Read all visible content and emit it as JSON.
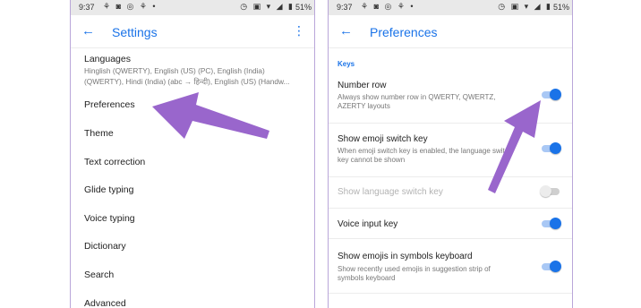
{
  "left_screen": {
    "status_bar": {
      "time": "9:37",
      "left_icons": "⚘ ◙ ◎ ⚘ •",
      "right_icons": "◷ ▣ ▾ ◢ ▮",
      "battery": "51%"
    },
    "toolbar": {
      "title": "Settings"
    },
    "languages": {
      "title": "Languages",
      "line1": "Hinglish (QWERTY), English (US) (PC), English (India)",
      "line2": "(QWERTY), Hindi (India) (abc → हिन्दी), English (US) (Handw..."
    },
    "items": [
      "Preferences",
      "Theme",
      "Text correction",
      "Glide typing",
      "Voice typing",
      "Dictionary",
      "Search",
      "Advanced"
    ]
  },
  "right_screen": {
    "status_bar": {
      "time": "9:37",
      "left_icons": "⚘ ◙ ◎ ⚘ •",
      "right_icons": "◷ ▣ ▾ ◢ ▮",
      "battery": "51%"
    },
    "toolbar": {
      "title": "Preferences"
    },
    "section_keys": "Keys",
    "prefs": [
      {
        "title": "Number row",
        "subtitle": "Always show number row in QWERTY, QWERTZ, AZERTY layouts",
        "enabled": true,
        "disabled": false
      },
      {
        "title": "Show emoji switch key",
        "subtitle": "When emoji switch key is enabled, the language switch key cannot be shown",
        "enabled": true,
        "disabled": false
      },
      {
        "title": "Show language switch key",
        "subtitle": "",
        "enabled": false,
        "disabled": true
      },
      {
        "title": "Voice input key",
        "subtitle": "",
        "enabled": true,
        "disabled": false
      },
      {
        "title": "Show emojis in symbols keyboard",
        "subtitle": "Show recently used emojis in suggestion strip of symbols keyboard",
        "enabled": true,
        "disabled": false
      }
    ]
  },
  "colors": {
    "accent": "#1a73e8",
    "arrow": "#9966cc",
    "frame": "#b9a6d9"
  }
}
